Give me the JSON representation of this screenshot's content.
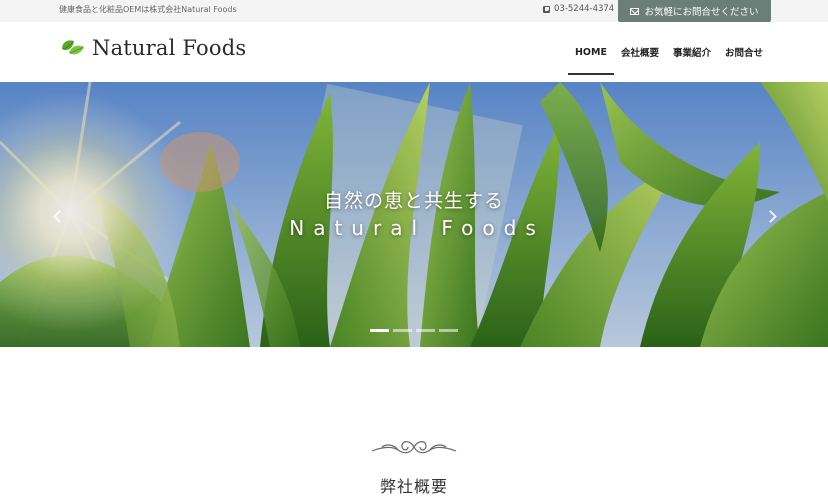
{
  "topbar": {
    "tagline": "健康食品と化粧品OEMは株式会社Natural Foods",
    "phone": "03-5244-4374",
    "contact_label": "お気軽にお問合せください"
  },
  "header": {
    "logo_text": "Natural Foods",
    "nav": [
      {
        "label": "HOME"
      },
      {
        "label": "会社概要"
      },
      {
        "label": "事業紹介"
      },
      {
        "label": "お問合せ"
      }
    ]
  },
  "hero": {
    "title_jp": "自然の恵と共生する",
    "title_en": "Natural Foods",
    "slides_total": 4,
    "active_slide": 1
  },
  "section": {
    "title": "弊社概要"
  },
  "colors": {
    "contact_button": "#6b7f78",
    "leaf_green": "#6dbb3a",
    "topbar_bg": "#f4f4f4"
  }
}
